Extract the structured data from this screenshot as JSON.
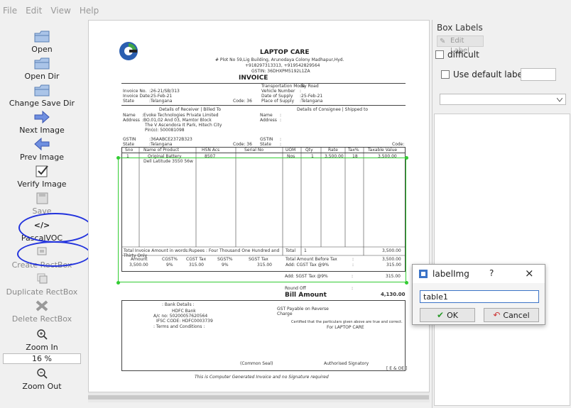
{
  "menu": [
    "File",
    "Edit",
    "View",
    "Help"
  ],
  "toolbar": {
    "open": "Open",
    "open_dir": "Open Dir",
    "change_save_dir": "Change Save Dir",
    "next_image": "Next Image",
    "prev_image": "Prev Image",
    "verify_image": "Verify Image",
    "save": "Save",
    "format_symbol": "</>",
    "format": "PascalVOC",
    "create_rectbox": "Create RectBox",
    "duplicate_rectbox": "Duplicate RectBox",
    "delete_rectbox": "Delete RectBox",
    "zoom_in": "Zoom In",
    "zoom_value": "16 %",
    "zoom_out": "Zoom Out"
  },
  "right_panel": {
    "title": "Box Labels",
    "edit_label": "Edit Label",
    "difficult": "difficult",
    "use_default_label": "Use default label"
  },
  "dialog": {
    "title": "labelImg",
    "help": "?",
    "close": "×",
    "input_value": "table1",
    "ok": "OK",
    "cancel": "Cancel"
  },
  "document": {
    "company": "LAPTOP CARE",
    "address": "# Plot No 59,Lig Building, Arunodaya Colony Madhapur,Hyd.",
    "phone": "+918297313313, +919542829564",
    "gstin": "GSTIN: 36DHXPM5192L1ZA",
    "doc_title": "INVOICE",
    "meta_left": [
      [
        "Invoice No.",
        ":26-21/SB/313"
      ],
      [
        "Invoice Date",
        ":25-Feb-21"
      ],
      [
        "State",
        ":Telangana"
      ]
    ],
    "state_code": "Code: 36",
    "meta_right": [
      [
        "Transportation Mode",
        ":By Road"
      ],
      [
        "Vehicle Number",
        ":"
      ],
      [
        "Date of Supply",
        ":25-Feb-21"
      ],
      [
        "Place of Supply",
        ":Telangana"
      ]
    ],
    "receiver_header": "Details of Receiver | Billed To",
    "consignee_header": "Details of Consignee | Shipped to",
    "receiver": [
      [
        "Name",
        ":Evoke Technologies Private Limited"
      ],
      [
        "Address",
        ":BO.01,02 And 03, Mamtor Block"
      ],
      [
        "",
        "The V Ascendora It Park, Hitech City"
      ],
      [
        "",
        "Pin(o): 500081098"
      ]
    ],
    "consignee": [
      [
        "Name",
        ":"
      ],
      [
        "Address",
        ":"
      ]
    ],
    "gstin_row": [
      "GSTIN",
      ":36AABCE2372B323",
      "GSTIN",
      ":"
    ],
    "state_row": [
      "State",
      ":Telangana",
      "Code: 36",
      "State",
      ":",
      "Code:"
    ],
    "table_headers": [
      "Sno",
      "Name of Product",
      "HSN Acs",
      "Serial No",
      "UOM",
      "Qty",
      "Rate",
      "Tax%",
      "Taxable Value"
    ],
    "table_rows": [
      [
        "1",
        "Original Battery",
        "8507",
        "",
        "Nos",
        "1",
        "3,500.00",
        "18",
        "3,500.00"
      ],
      [
        "",
        "Dell Latitude 3550 56w",
        "",
        "",
        "",
        "",
        "",
        "",
        ""
      ]
    ],
    "amount_words": "Total Invoice Amount in words:Rupees : Four Thousand One Hundred and Thirty Only",
    "total_label": "Total",
    "total_qty": "1",
    "total_value": "3,500.00",
    "tax_headers": [
      "Amount",
      "CGST%",
      "CGST Tax",
      "SGST%",
      "SGST Tax"
    ],
    "tax_values": [
      "3,500.00",
      "9%",
      "315.00",
      "9%",
      "315.00"
    ],
    "summary": [
      [
        "Total Amount Before Tax",
        ":",
        "3,500.00"
      ],
      [
        "Add: CGST Tax @9%",
        ":",
        "315.00"
      ],
      [
        "Add: SGST Tax @9%",
        ":",
        "315.00"
      ],
      [
        "Round Off",
        ":",
        ""
      ]
    ],
    "bill_amount_label": "Bill Amount",
    "bill_amount": "4,130.00",
    "bank_header": ": Bank Details :",
    "bank_name": "HDFC Bank",
    "account": "A/c no: 50200057620564",
    "ifsc": "IFSC CODE: HDFC0003739",
    "terms": ": Terms and Conditions :",
    "gst_reverse": "GST Payable on Reverse Charge",
    "certified": "Certified that the particulars given above are true and correct.",
    "for_company": "For LAPTOP CARE",
    "common_seal": "(Common Seal)",
    "auth_sign": "Authorised Signatory",
    "eoe": "[ E & OE ]",
    "footer": "This is Computer Generated Invoice and no Signature required"
  }
}
